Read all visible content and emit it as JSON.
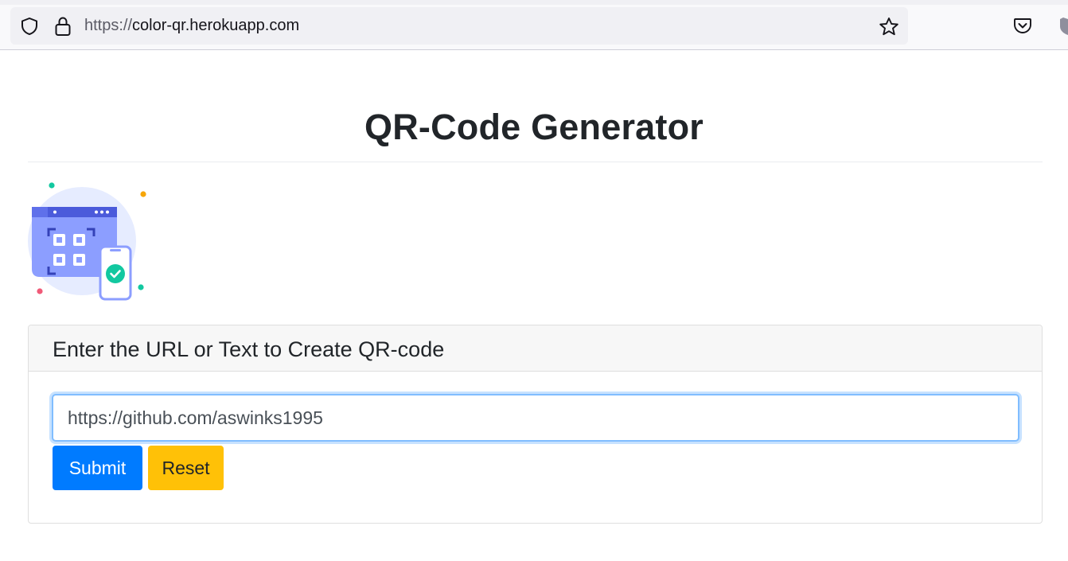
{
  "browser": {
    "url_protocol": "https://",
    "url_host": "color-qr.herokuapp.com",
    "icons": [
      "shield-icon",
      "lock-icon",
      "bookmark-star-icon",
      "pocket-icon",
      "extension-icon"
    ]
  },
  "page": {
    "title": "QR-Code Generator",
    "illustration": "qr-scan-illustration"
  },
  "form": {
    "header": "Enter the URL or Text to Create QR-code",
    "input_value": "https://github.com/aswinks1995",
    "submit_label": "Submit",
    "reset_label": "Reset"
  },
  "colors": {
    "primary": "#007bff",
    "warning": "#ffc107",
    "text": "#212529"
  }
}
